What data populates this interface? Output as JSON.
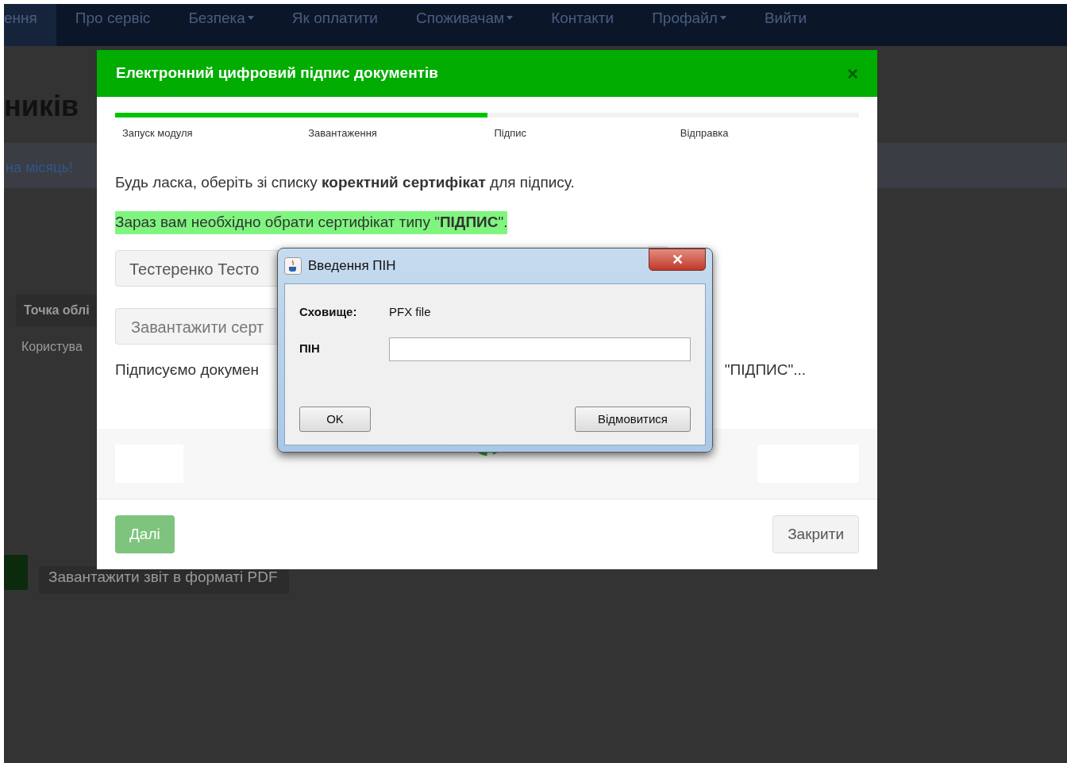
{
  "navbar": {
    "items": [
      {
        "label": "ення",
        "dropdown": false,
        "selected": true
      },
      {
        "label": "Про сервіс",
        "dropdown": false,
        "selected": false
      },
      {
        "label": "Безпека",
        "dropdown": true,
        "selected": false
      },
      {
        "label": "Як оплатити",
        "dropdown": false,
        "selected": false
      },
      {
        "label": "Споживачам",
        "dropdown": true,
        "selected": false
      },
      {
        "label": "Контакти",
        "dropdown": false,
        "selected": false
      },
      {
        "label": "Профайл",
        "dropdown": true,
        "selected": false
      },
      {
        "label": "Вийти",
        "dropdown": false,
        "selected": false
      }
    ]
  },
  "page": {
    "heading": "ників",
    "banner": "на місяць!",
    "table_header": "Точка облі",
    "table_cell": "Користува",
    "pdf_button": "Завантажити звіт в форматі PDF"
  },
  "modal": {
    "title": "Електронний цифровий підпис документів",
    "close": "×",
    "progress": {
      "level": 0.5,
      "steps": [
        "Запуск модуля",
        "Завантаження",
        "Підпис",
        "Відправка"
      ]
    },
    "instruction": "Будь ласка, оберіть зі списку **коректний сертифікат** для підпису.",
    "notice": "Зараз вам необхідно обрати сертифікат типу \"**ПІДПИС**\".",
    "certificate_select": "Тестеренко Тесто",
    "upload_button": "Завантажити серт",
    "status_left": "Підписуємо докумен",
    "status_right": "\"ПІДПИС\"...",
    "buttons": [
      {
        "label": "Далі",
        "kind": "primary",
        "disabled": true
      },
      {
        "label": "Закрити",
        "kind": "secondary",
        "disabled": false
      }
    ]
  },
  "pin_dialog": {
    "title": "Введення ПІН",
    "close": "✕",
    "storage_label": "Сховище:",
    "storage_value": "PFX file",
    "pin_label": "ПІН",
    "ok": "OK",
    "cancel": "Відмовитися"
  }
}
